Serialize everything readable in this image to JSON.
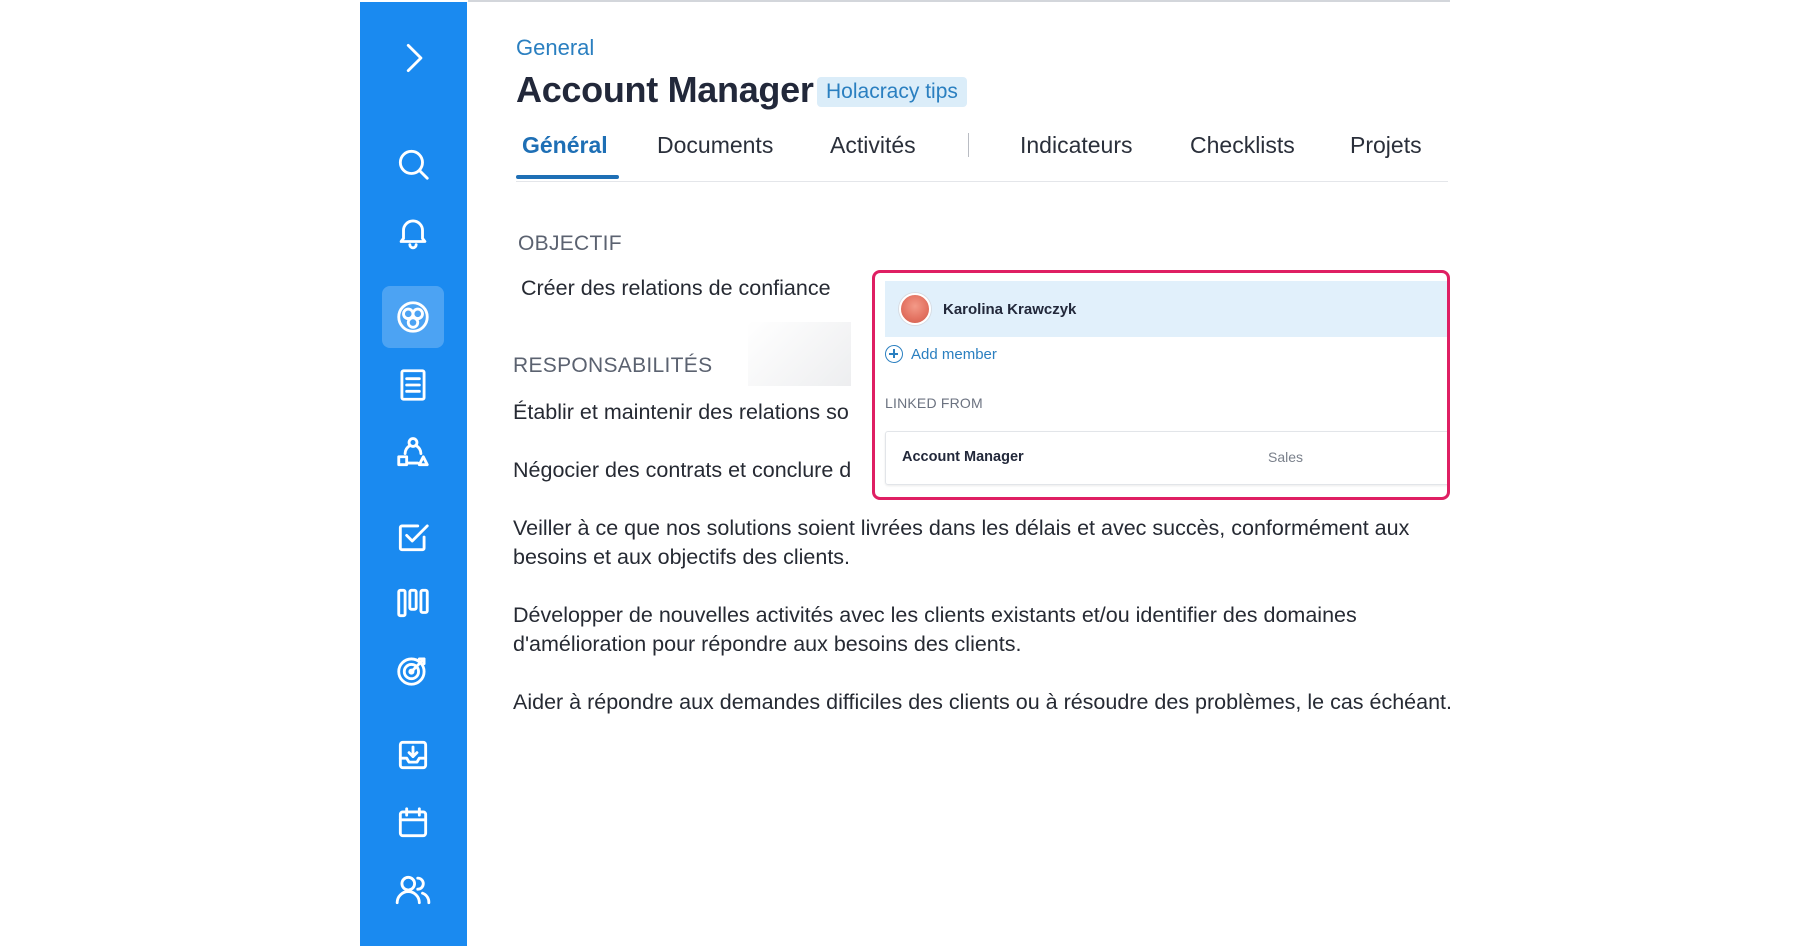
{
  "sidebar": {
    "accent_color": "#1a8af0",
    "items": [
      {
        "icon": "chevron-right-icon",
        "active": false
      },
      {
        "icon": "search-icon",
        "active": false
      },
      {
        "icon": "bell-icon",
        "active": false
      },
      {
        "icon": "circles-icon",
        "active": true
      },
      {
        "icon": "document-icon",
        "active": false
      },
      {
        "icon": "roles-icon",
        "active": false
      },
      {
        "icon": "checkbox-icon",
        "active": false
      },
      {
        "icon": "kanban-icon",
        "active": false
      },
      {
        "icon": "target-icon",
        "active": false
      },
      {
        "icon": "inbox-icon",
        "active": false
      },
      {
        "icon": "calendar-icon",
        "active": false
      },
      {
        "icon": "users-icon",
        "active": false
      }
    ]
  },
  "header": {
    "breadcrumb": "General",
    "title": "Account Manager",
    "tips_badge": "Holacracy tips"
  },
  "tabs": [
    {
      "label": "Général",
      "active": true
    },
    {
      "label": "Documents",
      "active": false
    },
    {
      "label": "Activités",
      "active": false
    },
    {
      "label": "Indicateurs",
      "active": false
    },
    {
      "label": "Checklists",
      "active": false
    },
    {
      "label": "Projets",
      "active": false
    }
  ],
  "content": {
    "objective_label": "OBJECTIF",
    "objective_text": "Créer des relations de confiance",
    "responsibilities_label": "RESPONSABILITÉS",
    "responsibilities": [
      "Établir et maintenir des relations so",
      "Négocier des contrats et conclure d",
      "Veiller à ce que nos solutions soient livrées dans les délais et avec succès, conformément aux besoins et aux objectifs des clients.",
      "Développer de nouvelles activités avec les clients existants et/ou identifier des domaines d'amélioration pour répondre aux besoins des clients.",
      "Aider à répondre aux demandes difficiles des clients ou à résoudre des problèmes, le cas échéant."
    ]
  },
  "popover": {
    "highlight_color": "#df1f63",
    "member_name": "Karolina Krawczyk",
    "add_member_label": "Add member",
    "linked_from_label": "LINKED FROM",
    "linked_role": "Account Manager",
    "linked_circle": "Sales"
  }
}
